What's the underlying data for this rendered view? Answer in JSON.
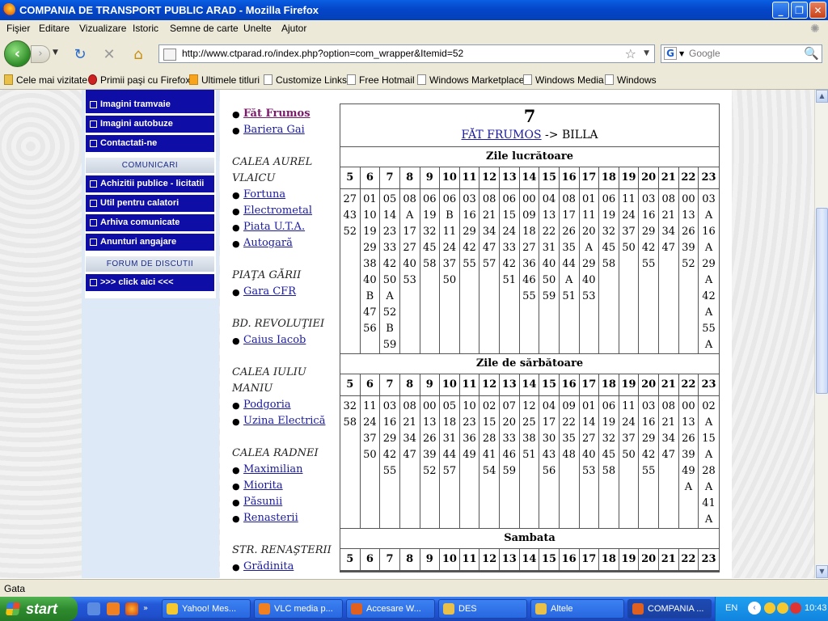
{
  "window": {
    "title": "COMPANIA DE TRANSPORT PUBLIC ARAD - Mozilla Firefox",
    "controls": [
      "_",
      "❐",
      "✕"
    ]
  },
  "menu": [
    "Fişier",
    "Editare",
    "Vizualizare",
    "Istoric",
    "Semne de carte",
    "Unelte",
    "Ajutor"
  ],
  "nav": {
    "url": "http://www.ctparad.ro/index.php?option=com_wrapper&Itemid=52",
    "search_placeholder": "Google"
  },
  "bookmarks": [
    "Cele mai vizitate",
    "Primii paşi cu Firefox",
    "Ultimele titluri",
    "Customize Links",
    "Free Hotmail",
    "Windows Marketplace",
    "Windows Media",
    "Windows"
  ],
  "sidebar": {
    "items_top": [
      "Imagini tramvaie",
      "Imagini autobuze",
      "Contactati-ne"
    ],
    "header1": "COMUNICARI",
    "items_mid": [
      "Achizitii publice - licitatii",
      "Util pentru calatori",
      "Arhiva comunicate",
      "Anunturi angajare"
    ],
    "header2": "FORUM DE DISCUTII",
    "items_bottom": [
      ">>> click aici <<<"
    ]
  },
  "stations": {
    "top_links": [
      "Făt Frumos",
      "Bariera Gai"
    ],
    "sections": [
      {
        "name": "CALEA AUREL VLAICU",
        "links": [
          "Fortuna",
          "Electrometal",
          "Piata U.T.A.",
          "Autogară"
        ]
      },
      {
        "name": "PIAŢA GĂRII",
        "links": [
          "Gara CFR"
        ]
      },
      {
        "name": "BD. REVOLUŢIEI",
        "links": [
          "Caius Iacob"
        ]
      },
      {
        "name": "CALEA IULIU MANIU",
        "links": [
          "Podgoria",
          "Uzina Electrică"
        ]
      },
      {
        "name": "CALEA RADNEI",
        "links": [
          "Maximilian",
          "Miorita",
          "Păsunii",
          "Renasterii"
        ]
      },
      {
        "name": "STR. RENAŞTERII",
        "links": [
          "Grădinita"
        ]
      }
    ]
  },
  "timetable": {
    "line": "7",
    "from": "FĂT FRUMOS",
    "arrow": "->",
    "to": "BILLA",
    "hours": [
      "5",
      "6",
      "7",
      "8",
      "9",
      "10",
      "11",
      "12",
      "13",
      "14",
      "15",
      "16",
      "17",
      "18",
      "19",
      "20",
      "21",
      "22",
      "23"
    ],
    "sections": [
      {
        "title": "Zile lucrătoare",
        "minutes": [
          [
            "27",
            "43",
            "52"
          ],
          [
            "01",
            "10",
            "19",
            "29",
            "38",
            "40",
            "B",
            "47",
            "56"
          ],
          [
            "05",
            "14",
            "23",
            "33",
            "42",
            "50",
            "A",
            "52",
            "B",
            "59"
          ],
          [
            "08",
            "A",
            "17",
            "27",
            "40",
            "53"
          ],
          [
            "06",
            "19",
            "32",
            "45",
            "58"
          ],
          [
            "06",
            "B",
            "11",
            "24",
            "37",
            "50"
          ],
          [
            "03",
            "16",
            "29",
            "42",
            "55"
          ],
          [
            "08",
            "21",
            "34",
            "47",
            "57"
          ],
          [
            "06",
            "15",
            "24",
            "33",
            "42",
            "51"
          ],
          [
            "00",
            "09",
            "18",
            "27",
            "36",
            "46",
            "55"
          ],
          [
            "04",
            "13",
            "22",
            "31",
            "40",
            "50",
            "59"
          ],
          [
            "08",
            "17",
            "26",
            "35",
            "44",
            "A",
            "51"
          ],
          [
            "01",
            "11",
            "20",
            "A",
            "29",
            "40",
            "53"
          ],
          [
            "06",
            "19",
            "32",
            "45",
            "58"
          ],
          [
            "11",
            "24",
            "37",
            "50"
          ],
          [
            "03",
            "16",
            "29",
            "42",
            "55"
          ],
          [
            "08",
            "21",
            "34",
            "47"
          ],
          [
            "00",
            "13",
            "26",
            "39",
            "52"
          ],
          [
            "03",
            "A",
            "16",
            "A",
            "29",
            "A",
            "42",
            "A",
            "55",
            "A"
          ]
        ]
      },
      {
        "title": "Zile de sărbătoare",
        "minutes": [
          [
            "32",
            "58"
          ],
          [
            "11",
            "24",
            "37",
            "50"
          ],
          [
            "03",
            "16",
            "29",
            "42",
            "55"
          ],
          [
            "08",
            "21",
            "34",
            "47"
          ],
          [
            "00",
            "13",
            "26",
            "39",
            "52"
          ],
          [
            "05",
            "18",
            "31",
            "44",
            "57"
          ],
          [
            "10",
            "23",
            "36",
            "49"
          ],
          [
            "02",
            "15",
            "28",
            "41",
            "54"
          ],
          [
            "07",
            "20",
            "33",
            "46",
            "59"
          ],
          [
            "12",
            "25",
            "38",
            "51"
          ],
          [
            "04",
            "17",
            "30",
            "43",
            "56"
          ],
          [
            "09",
            "22",
            "35",
            "48"
          ],
          [
            "01",
            "14",
            "27",
            "40",
            "53"
          ],
          [
            "06",
            "19",
            "32",
            "45",
            "58"
          ],
          [
            "11",
            "24",
            "37",
            "50"
          ],
          [
            "03",
            "16",
            "29",
            "42",
            "55"
          ],
          [
            "08",
            "21",
            "34",
            "47"
          ],
          [
            "00",
            "13",
            "26",
            "39",
            "49",
            "A"
          ],
          [
            "02",
            "A",
            "15",
            "A",
            "28",
            "A",
            "41",
            "A"
          ]
        ]
      },
      {
        "title": "Sambata",
        "minutes": []
      }
    ]
  },
  "status": "Gata",
  "taskbar": {
    "start": "start",
    "tasks": [
      "Yahoo! Mes...",
      "VLC media p...",
      "Accesare W...",
      "DES",
      "Altele",
      "COMPANIA ..."
    ],
    "lang": "EN",
    "clock": "10:43"
  },
  "colors": {
    "sidebar_blue": "#0e0ea6",
    "link": "#1a1a9e",
    "visited": "#7a1a6a",
    "xp_blue": "#2459d8"
  }
}
